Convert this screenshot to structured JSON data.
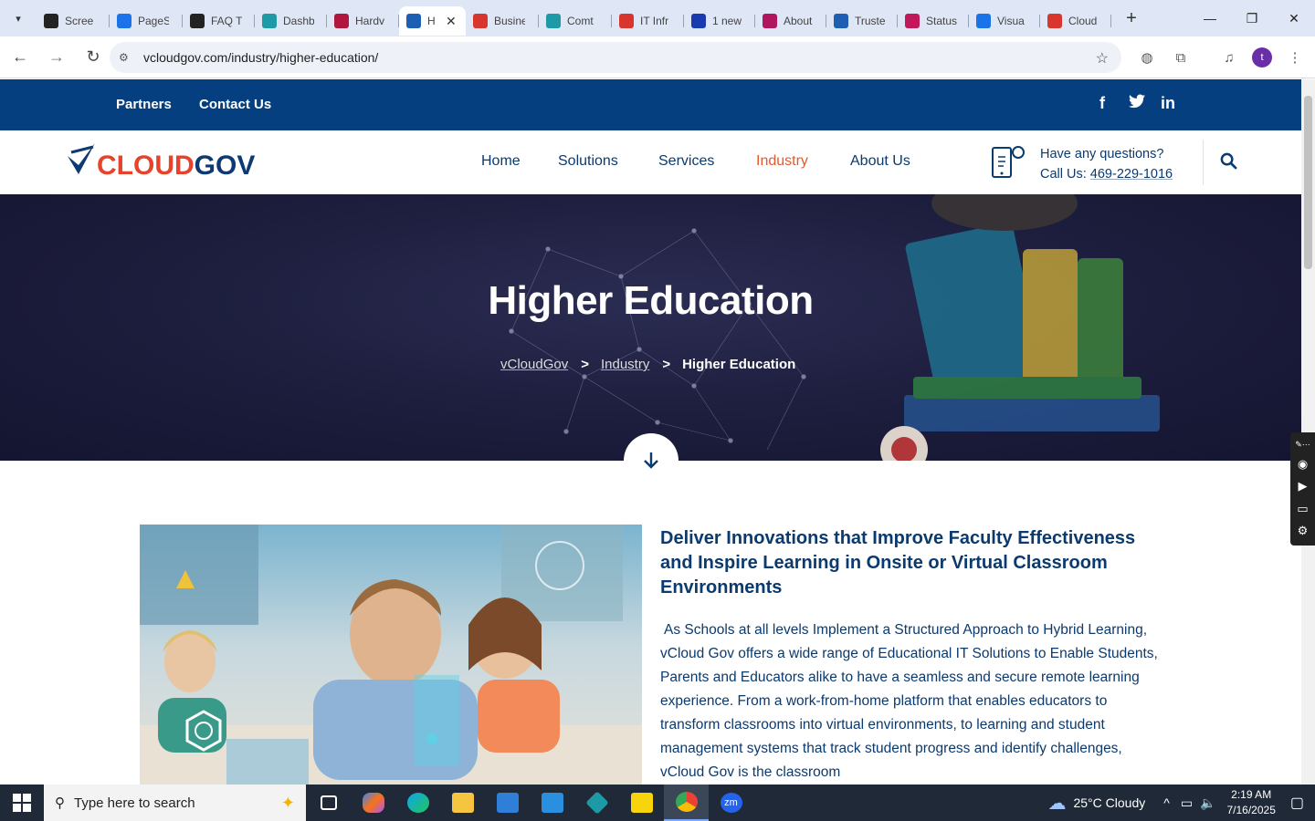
{
  "browser": {
    "tabs": [
      {
        "label": "Scree",
        "fav_color": "#222"
      },
      {
        "label": "PageS",
        "fav_color": "#1a73e8"
      },
      {
        "label": "FAQ T",
        "fav_color": "#222"
      },
      {
        "label": "Dashb",
        "fav_color": "#1e9aa6"
      },
      {
        "label": "Hardv",
        "fav_color": "#b0163e"
      },
      {
        "label": "H",
        "fav_color": "#1d5fb3",
        "active": true
      },
      {
        "label": "Busine",
        "fav_color": "#d9352f"
      },
      {
        "label": "Comt",
        "fav_color": "#1e9aa6"
      },
      {
        "label": "IT Infr",
        "fav_color": "#d9352f"
      },
      {
        "label": "1 new",
        "fav_color": "#1a3bb0"
      },
      {
        "label": "About",
        "fav_color": "#b0165e"
      },
      {
        "label": "Truste",
        "fav_color": "#1d5fb3"
      },
      {
        "label": "Status",
        "fav_color": "#c2185b"
      },
      {
        "label": "Visua",
        "fav_color": "#1a73e8"
      },
      {
        "label": "Cloud",
        "fav_color": "#d9352f"
      }
    ],
    "url": "vcloudgov.com/industry/higher-education/",
    "profile_initial": "t"
  },
  "topbar": {
    "partners": "Partners",
    "contact": "Contact Us",
    "social": [
      "f",
      "t",
      "in"
    ]
  },
  "logo": {
    "part1": "CLOUD",
    "part2": "GOV"
  },
  "nav": {
    "items": [
      "Home",
      "Solutions",
      "Services",
      "Industry",
      "About Us"
    ],
    "active": "Industry"
  },
  "questions": {
    "line1": "Have any questions?",
    "call_prefix": "Call Us: ",
    "phone": "469-229-1016"
  },
  "hero": {
    "title": "Higher Education",
    "breadcrumb": [
      "vCloudGov",
      "Industry",
      "Higher Education"
    ],
    "separator": ">"
  },
  "content": {
    "heading": "Deliver Innovations that Improve Faculty Effectiveness and Inspire Learning in Onsite or Virtual Classroom Environments",
    "paragraph": "As Schools at all levels Implement a Structured Approach to Hybrid Learning, vCloud Gov offers a wide range of Educational IT Solutions to Enable Students, Parents and Educators alike to have a seamless and secure remote learning experience. From a work-from-home platform that enables educators to transform classrooms into virtual environments, to learning and student management systems that track student progress and identify challenges, vCloud Gov is the classroom"
  },
  "taskbar": {
    "search_placeholder": "Type here to search",
    "weather": "25°C  Cloudy",
    "time": "2:19 AM",
    "date": "7/16/2025"
  },
  "colors": {
    "navy": "#063f80",
    "accent": "#e35a2d",
    "text": "#0b3a6e"
  }
}
